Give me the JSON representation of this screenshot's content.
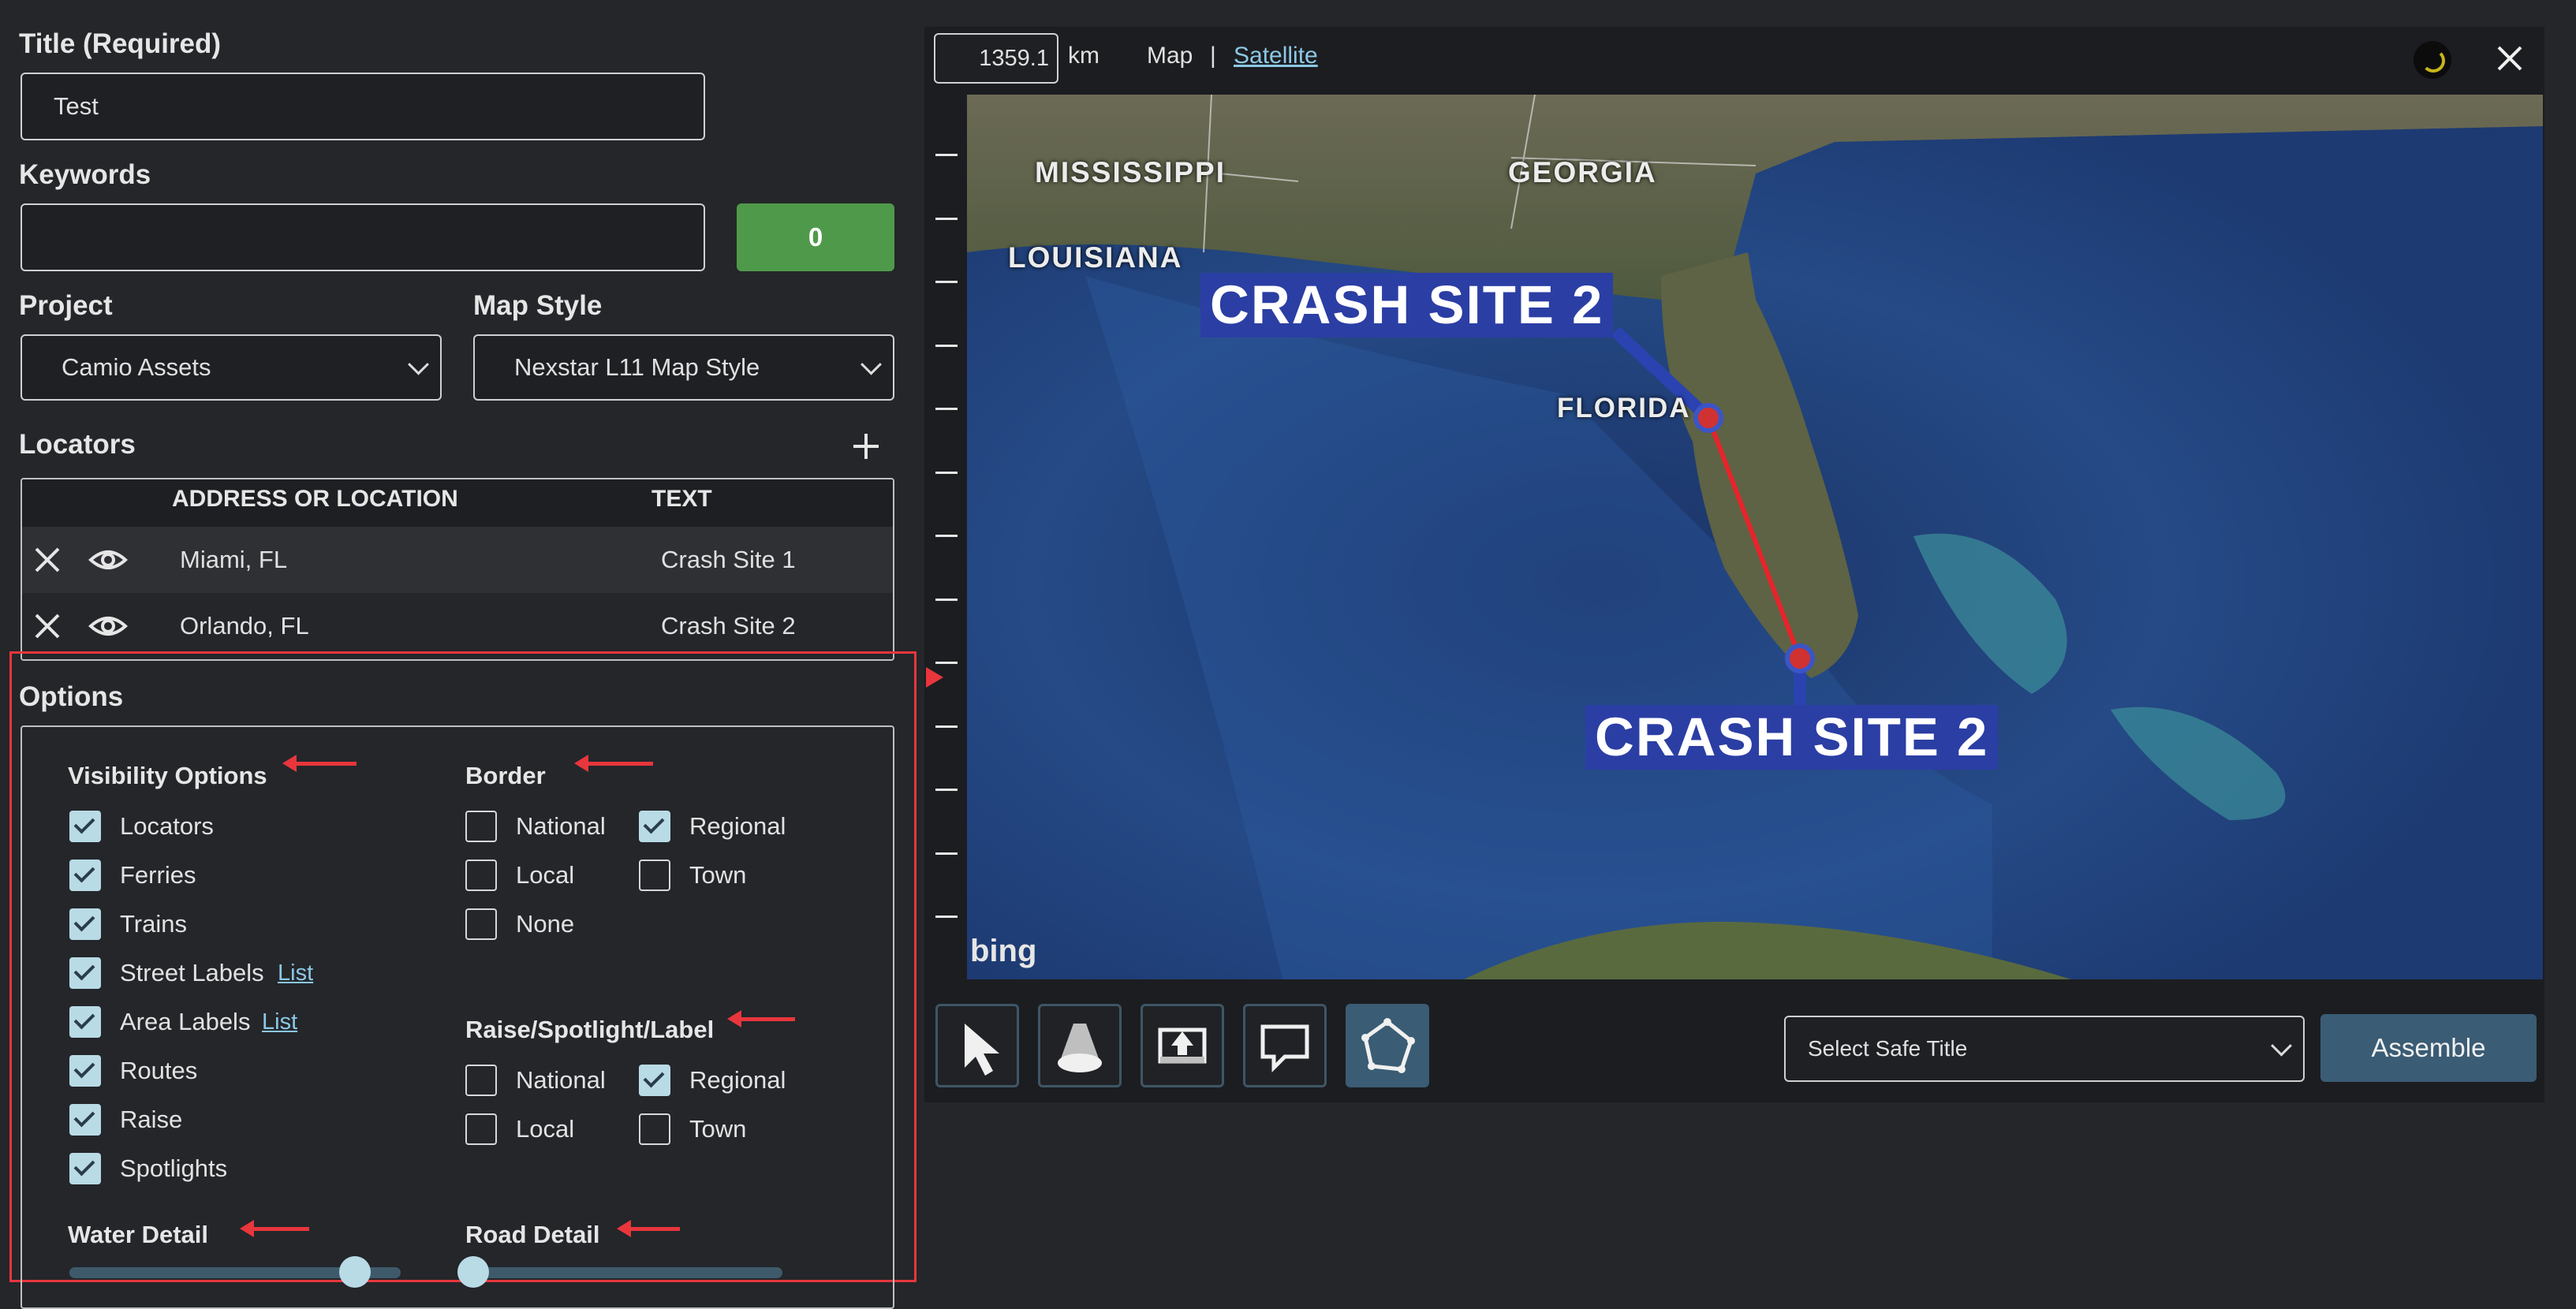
{
  "form": {
    "title_label": "Title (Required)",
    "title_value": "Test",
    "keywords_label": "Keywords",
    "keywords_value": "",
    "keywords_count": "0",
    "project_label": "Project",
    "project_value": "Camio Assets",
    "mapstyle_label": "Map Style",
    "mapstyle_value": "Nexstar L11 Map Style"
  },
  "locators": {
    "label": "Locators",
    "col_address": "ADDRESS OR LOCATION",
    "col_text": "TEXT",
    "rows": [
      {
        "address": "Miami, FL",
        "text": "Crash Site 1"
      },
      {
        "address": "Orlando, FL",
        "text": "Crash Site 2"
      }
    ]
  },
  "options": {
    "label": "Options",
    "visibility": {
      "title": "Visibility Options",
      "items": [
        {
          "label": "Locators",
          "checked": true
        },
        {
          "label": "Ferries",
          "checked": true
        },
        {
          "label": "Trains",
          "checked": true
        },
        {
          "label": "Street Labels",
          "checked": true,
          "link": "List"
        },
        {
          "label": "Area Labels",
          "checked": true,
          "link": "List"
        },
        {
          "label": "Routes",
          "checked": true
        },
        {
          "label": "Raise",
          "checked": true
        },
        {
          "label": "Spotlights",
          "checked": true
        }
      ]
    },
    "border": {
      "title": "Border",
      "items": [
        {
          "label": "National",
          "checked": false
        },
        {
          "label": "Regional",
          "checked": true
        },
        {
          "label": "Local",
          "checked": false
        },
        {
          "label": "Town",
          "checked": false
        },
        {
          "label": "None",
          "checked": false
        }
      ]
    },
    "raise": {
      "title": "Raise/Spotlight/Label",
      "items": [
        {
          "label": "National",
          "checked": false
        },
        {
          "label": "Regional",
          "checked": true
        },
        {
          "label": "Local",
          "checked": false
        },
        {
          "label": "Town",
          "checked": false
        }
      ]
    },
    "water_detail": {
      "label": "Water Detail",
      "level": 0.9
    },
    "road_detail": {
      "label": "Road Detail",
      "level": 0.0
    }
  },
  "map": {
    "distance": "1359.1",
    "unit": "km",
    "mode_map": "Map",
    "separator": "|",
    "mode_satellite": "Satellite",
    "labels": {
      "mississippi": "MISSISSIPPI",
      "georgia": "GEORGIA",
      "louisiana": "LOUISIANA",
      "florida": "FLORIDA",
      "bing": "bing"
    },
    "callouts": [
      "CRASH SITE 2",
      "CRASH SITE 2"
    ]
  },
  "toolbar": {
    "safe_title_placeholder": "Select Safe Title",
    "assemble_label": "Assemble"
  },
  "colors": {
    "accent_green": "#4f9a4a",
    "accent_blue": "#3a5c74",
    "highlight_red": "#e8363c",
    "check_fill": "#b9dbe6"
  }
}
